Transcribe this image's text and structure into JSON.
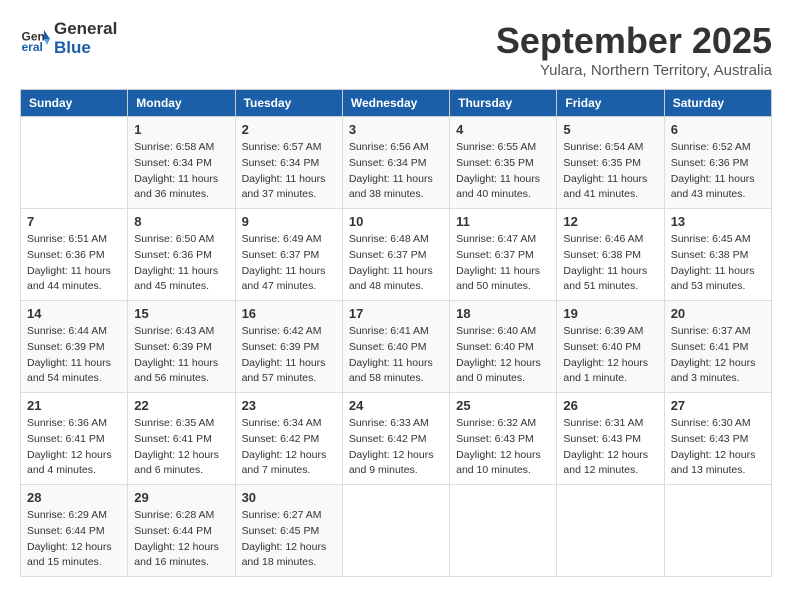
{
  "header": {
    "logo_text_general": "General",
    "logo_text_blue": "Blue",
    "month": "September 2025",
    "location": "Yulara, Northern Territory, Australia"
  },
  "calendar": {
    "days_of_week": [
      "Sunday",
      "Monday",
      "Tuesday",
      "Wednesday",
      "Thursday",
      "Friday",
      "Saturday"
    ],
    "weeks": [
      [
        {
          "day": "",
          "info": ""
        },
        {
          "day": "1",
          "info": "Sunrise: 6:58 AM\nSunset: 6:34 PM\nDaylight: 11 hours\nand 36 minutes."
        },
        {
          "day": "2",
          "info": "Sunrise: 6:57 AM\nSunset: 6:34 PM\nDaylight: 11 hours\nand 37 minutes."
        },
        {
          "day": "3",
          "info": "Sunrise: 6:56 AM\nSunset: 6:34 PM\nDaylight: 11 hours\nand 38 minutes."
        },
        {
          "day": "4",
          "info": "Sunrise: 6:55 AM\nSunset: 6:35 PM\nDaylight: 11 hours\nand 40 minutes."
        },
        {
          "day": "5",
          "info": "Sunrise: 6:54 AM\nSunset: 6:35 PM\nDaylight: 11 hours\nand 41 minutes."
        },
        {
          "day": "6",
          "info": "Sunrise: 6:52 AM\nSunset: 6:36 PM\nDaylight: 11 hours\nand 43 minutes."
        }
      ],
      [
        {
          "day": "7",
          "info": "Sunrise: 6:51 AM\nSunset: 6:36 PM\nDaylight: 11 hours\nand 44 minutes."
        },
        {
          "day": "8",
          "info": "Sunrise: 6:50 AM\nSunset: 6:36 PM\nDaylight: 11 hours\nand 45 minutes."
        },
        {
          "day": "9",
          "info": "Sunrise: 6:49 AM\nSunset: 6:37 PM\nDaylight: 11 hours\nand 47 minutes."
        },
        {
          "day": "10",
          "info": "Sunrise: 6:48 AM\nSunset: 6:37 PM\nDaylight: 11 hours\nand 48 minutes."
        },
        {
          "day": "11",
          "info": "Sunrise: 6:47 AM\nSunset: 6:37 PM\nDaylight: 11 hours\nand 50 minutes."
        },
        {
          "day": "12",
          "info": "Sunrise: 6:46 AM\nSunset: 6:38 PM\nDaylight: 11 hours\nand 51 minutes."
        },
        {
          "day": "13",
          "info": "Sunrise: 6:45 AM\nSunset: 6:38 PM\nDaylight: 11 hours\nand 53 minutes."
        }
      ],
      [
        {
          "day": "14",
          "info": "Sunrise: 6:44 AM\nSunset: 6:39 PM\nDaylight: 11 hours\nand 54 minutes."
        },
        {
          "day": "15",
          "info": "Sunrise: 6:43 AM\nSunset: 6:39 PM\nDaylight: 11 hours\nand 56 minutes."
        },
        {
          "day": "16",
          "info": "Sunrise: 6:42 AM\nSunset: 6:39 PM\nDaylight: 11 hours\nand 57 minutes."
        },
        {
          "day": "17",
          "info": "Sunrise: 6:41 AM\nSunset: 6:40 PM\nDaylight: 11 hours\nand 58 minutes."
        },
        {
          "day": "18",
          "info": "Sunrise: 6:40 AM\nSunset: 6:40 PM\nDaylight: 12 hours\nand 0 minutes."
        },
        {
          "day": "19",
          "info": "Sunrise: 6:39 AM\nSunset: 6:40 PM\nDaylight: 12 hours\nand 1 minute."
        },
        {
          "day": "20",
          "info": "Sunrise: 6:37 AM\nSunset: 6:41 PM\nDaylight: 12 hours\nand 3 minutes."
        }
      ],
      [
        {
          "day": "21",
          "info": "Sunrise: 6:36 AM\nSunset: 6:41 PM\nDaylight: 12 hours\nand 4 minutes."
        },
        {
          "day": "22",
          "info": "Sunrise: 6:35 AM\nSunset: 6:41 PM\nDaylight: 12 hours\nand 6 minutes."
        },
        {
          "day": "23",
          "info": "Sunrise: 6:34 AM\nSunset: 6:42 PM\nDaylight: 12 hours\nand 7 minutes."
        },
        {
          "day": "24",
          "info": "Sunrise: 6:33 AM\nSunset: 6:42 PM\nDaylight: 12 hours\nand 9 minutes."
        },
        {
          "day": "25",
          "info": "Sunrise: 6:32 AM\nSunset: 6:43 PM\nDaylight: 12 hours\nand 10 minutes."
        },
        {
          "day": "26",
          "info": "Sunrise: 6:31 AM\nSunset: 6:43 PM\nDaylight: 12 hours\nand 12 minutes."
        },
        {
          "day": "27",
          "info": "Sunrise: 6:30 AM\nSunset: 6:43 PM\nDaylight: 12 hours\nand 13 minutes."
        }
      ],
      [
        {
          "day": "28",
          "info": "Sunrise: 6:29 AM\nSunset: 6:44 PM\nDaylight: 12 hours\nand 15 minutes."
        },
        {
          "day": "29",
          "info": "Sunrise: 6:28 AM\nSunset: 6:44 PM\nDaylight: 12 hours\nand 16 minutes."
        },
        {
          "day": "30",
          "info": "Sunrise: 6:27 AM\nSunset: 6:45 PM\nDaylight: 12 hours\nand 18 minutes."
        },
        {
          "day": "",
          "info": ""
        },
        {
          "day": "",
          "info": ""
        },
        {
          "day": "",
          "info": ""
        },
        {
          "day": "",
          "info": ""
        }
      ]
    ]
  }
}
